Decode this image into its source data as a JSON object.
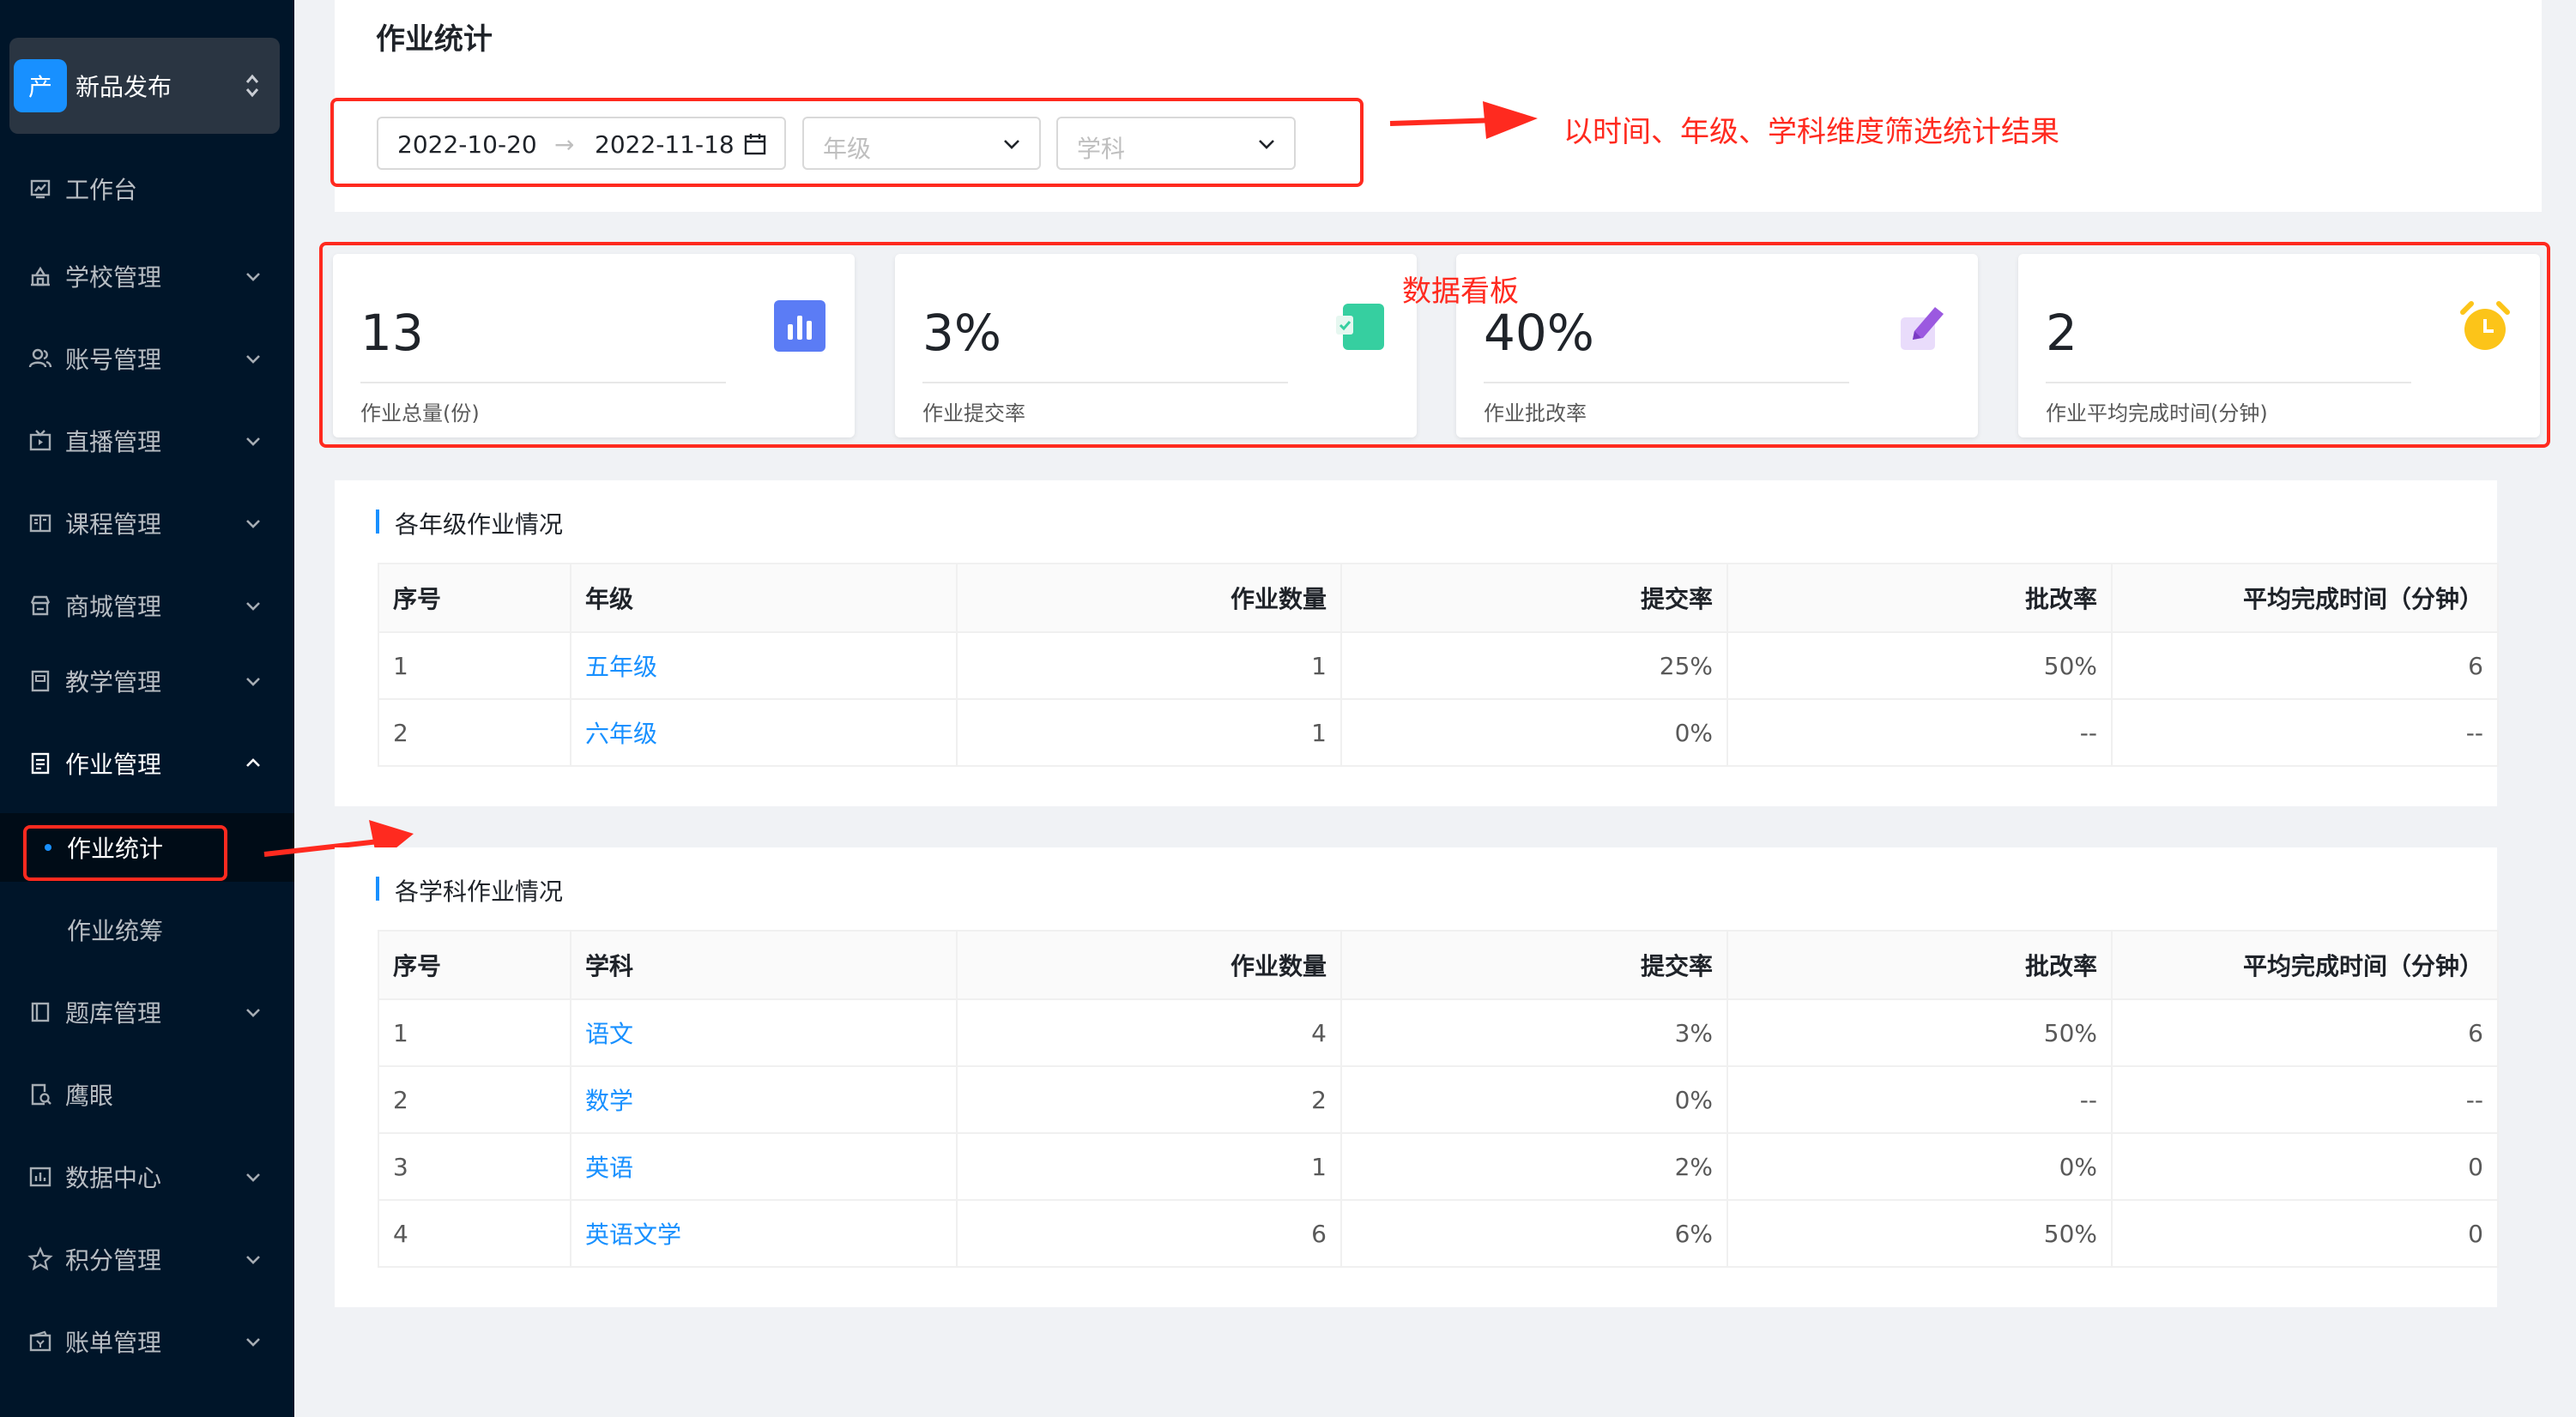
{
  "sidebar": {
    "app_logo_char": "产",
    "app_name": "新品发布",
    "items": [
      {
        "label": "工作台"
      },
      {
        "label": "学校管理"
      },
      {
        "label": "账号管理"
      },
      {
        "label": "直播管理"
      },
      {
        "label": "课程管理"
      },
      {
        "label": "商城管理"
      },
      {
        "label": "教学管理"
      },
      {
        "label": "作业管理"
      },
      {
        "label": "题库管理"
      },
      {
        "label": "鹰眼"
      },
      {
        "label": "数据中心"
      },
      {
        "label": "积分管理"
      },
      {
        "label": "账单管理"
      }
    ],
    "sub_items": [
      {
        "label": "作业统计"
      },
      {
        "label": "作业统筹"
      }
    ]
  },
  "page": {
    "title": "作业统计"
  },
  "filters": {
    "date_start": "2022-10-20",
    "date_separator": "→",
    "date_end": "2022-11-18",
    "grade_placeholder": "年级",
    "subject_placeholder": "学科"
  },
  "annotations": {
    "filter_note": "以时间、年级、学科维度筛选统计结果",
    "dashboard_note": "数据看板"
  },
  "stats": [
    {
      "value": "13",
      "label": "作业总量(份)",
      "icon": "bar-chart-icon",
      "color": "#5b7cf5"
    },
    {
      "value": "3%",
      "label": "作业提交率",
      "icon": "clipboard-check-icon",
      "color": "#36cfa0"
    },
    {
      "value": "40%",
      "label": "作业批改率",
      "icon": "pencil-edit-icon",
      "color": "#9b59e0"
    },
    {
      "value": "2",
      "label": "作业平均完成时间(分钟)",
      "icon": "alarm-clock-icon",
      "color": "#fcc419"
    }
  ],
  "grade_table": {
    "title": "各年级作业情况",
    "headers": [
      "序号",
      "年级",
      "作业数量",
      "提交率",
      "批改率",
      "平均完成时间（分钟）"
    ],
    "rows": [
      [
        "1",
        "五年级",
        "1",
        "25%",
        "50%",
        "6"
      ],
      [
        "2",
        "六年级",
        "1",
        "0%",
        "--",
        "--"
      ]
    ]
  },
  "subject_table": {
    "title": "各学科作业情况",
    "headers": [
      "序号",
      "学科",
      "作业数量",
      "提交率",
      "批改率",
      "平均完成时间（分钟）"
    ],
    "rows": [
      [
        "1",
        "语文",
        "4",
        "3%",
        "50%",
        "6"
      ],
      [
        "2",
        "数学",
        "2",
        "0%",
        "--",
        "--"
      ],
      [
        "3",
        "英语",
        "1",
        "2%",
        "0%",
        "0"
      ],
      [
        "4",
        "英语文学",
        "6",
        "6%",
        "50%",
        "0"
      ]
    ]
  },
  "colors": {
    "sidebar_bg": "#001529",
    "accent": "#1890ff",
    "annotation": "#ff2a1f"
  }
}
